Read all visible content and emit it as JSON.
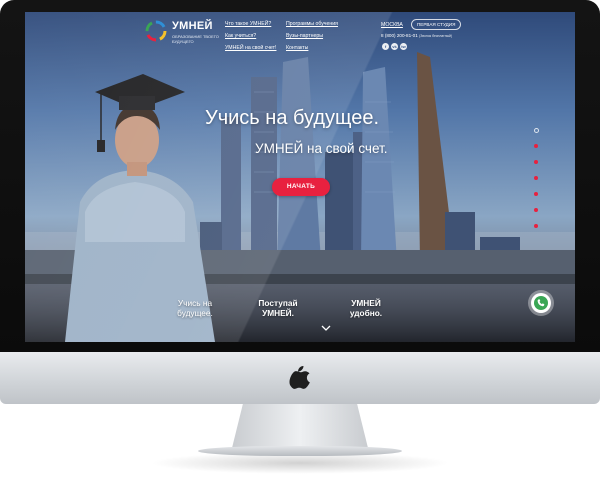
{
  "logo": {
    "name": "УМНЕЙ",
    "tagline": "ОБРАЗОВАНИЕ ТВОЕГО БУДУЩЕГО"
  },
  "nav": {
    "col1": [
      "Что такое УМНЕЙ?",
      "Как учиться?",
      "УМНЕЙ на свой счет!"
    ],
    "col2": [
      "Программы обучения",
      "Вузы-партнеры",
      "Контакты"
    ]
  },
  "header_right": {
    "city": "МОСКВА",
    "first_studio": "ПЕРВАЯ СТУДИЯ",
    "phone": "8 (800) 200-81-01",
    "phone_note": "(Звонок бесплатный)",
    "social": [
      "f",
      "vk",
      "tw"
    ]
  },
  "hero": {
    "title": "Учись на будущее.",
    "subtitle": "УМНЕЙ на свой счет.",
    "cta": "НАЧАТЬ"
  },
  "features": [
    {
      "line1": "Учись на",
      "line2": "будущее."
    },
    {
      "line1": "Поступай",
      "line2": "УМНЕЙ."
    },
    {
      "line1": "УМНЕЙ",
      "line2": "удобно."
    }
  ],
  "slider": {
    "slide_count": 7,
    "active_slide": 1
  },
  "icons": {
    "apple": "apple-logo-icon",
    "call": "phone-call-icon",
    "scroll": "chevron-down-icon"
  },
  "colors": {
    "accent": "#e8213f",
    "call_green": "#3aa655"
  }
}
